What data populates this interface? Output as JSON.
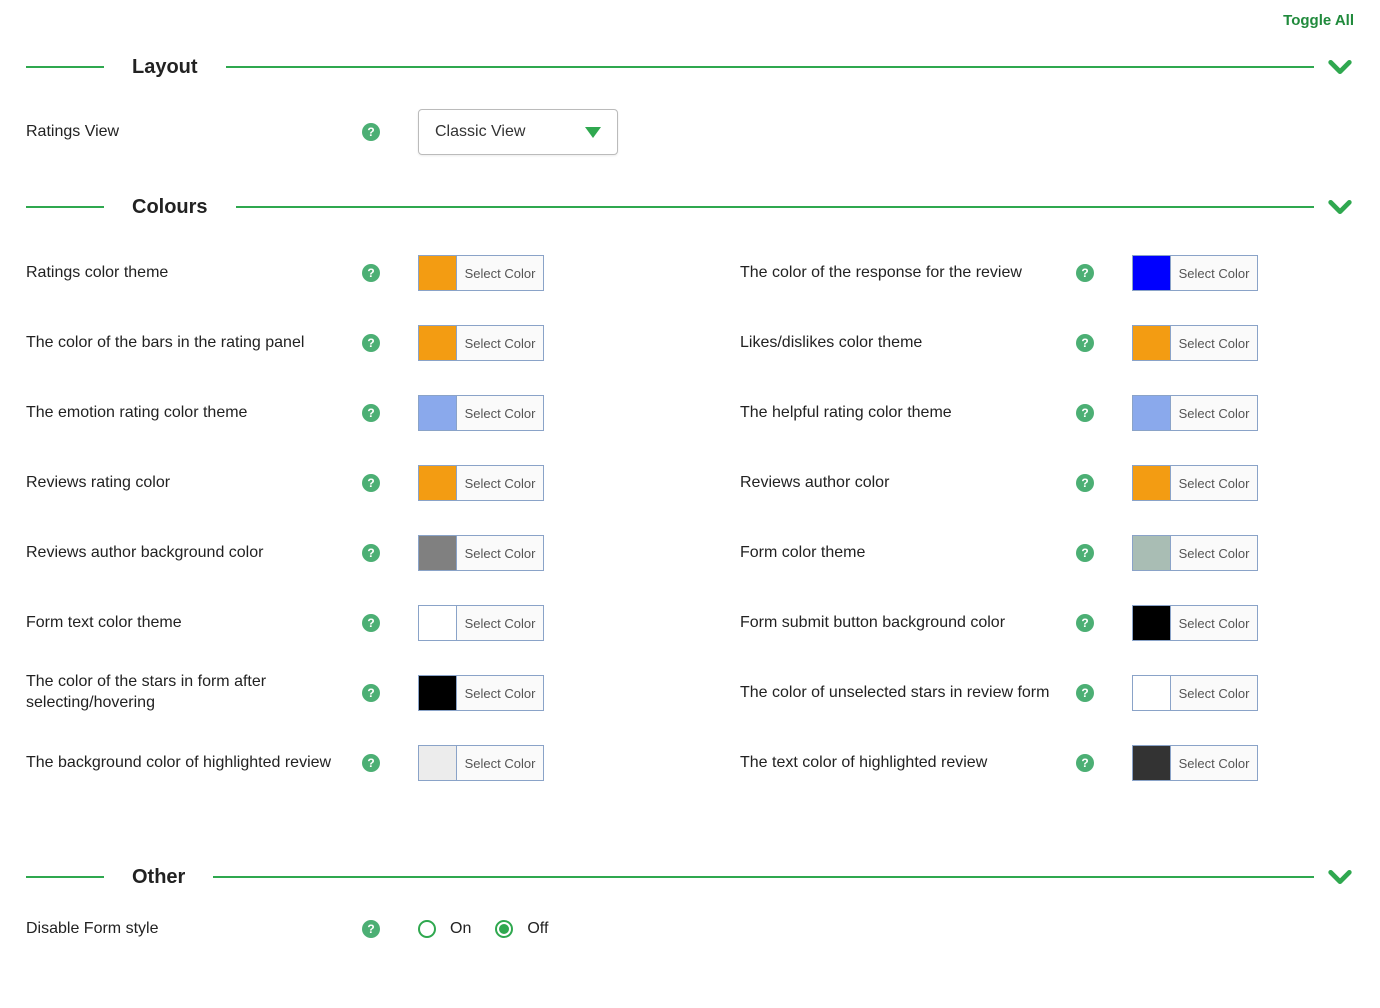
{
  "toggle_all": "Toggle All",
  "select_color_label": "Select Color",
  "sections": {
    "layout": {
      "title": "Layout",
      "ratings_view": {
        "label": "Ratings View",
        "value": "Classic View"
      }
    },
    "colours": {
      "title": "Colours",
      "items": [
        {
          "label": "Ratings color theme",
          "color": "#f39c12"
        },
        {
          "label": "The color of the response for the review",
          "color": "#0000ff"
        },
        {
          "label": "The color of the bars in the rating panel",
          "color": "#f39c12"
        },
        {
          "label": "Likes/dislikes color theme",
          "color": "#f39c12"
        },
        {
          "label": "The emotion rating color theme",
          "color": "#8aa9ec"
        },
        {
          "label": "The helpful rating color theme",
          "color": "#8aa9ec"
        },
        {
          "label": "Reviews rating color",
          "color": "#f39c12"
        },
        {
          "label": "Reviews author color",
          "color": "#f39c12"
        },
        {
          "label": "Reviews author background color",
          "color": "#808080"
        },
        {
          "label": "Form color theme",
          "color": "#a9bdb4"
        },
        {
          "label": "Form text color theme",
          "color": "#ffffff"
        },
        {
          "label": "Form submit button background color",
          "color": "#000000"
        },
        {
          "label": "The color of the stars in form after selecting/hovering",
          "color": "#000000"
        },
        {
          "label": "The color of unselected stars in review form",
          "color": "#ffffff"
        },
        {
          "label": "The background color of highlighted review",
          "color": "#ececec"
        },
        {
          "label": "The text color of highlighted review",
          "color": "#333333"
        }
      ]
    },
    "other": {
      "title": "Other",
      "disable_form_style": {
        "label": "Disable Form style",
        "value": "Off",
        "options": {
          "on": "On",
          "off": "Off"
        }
      }
    }
  }
}
